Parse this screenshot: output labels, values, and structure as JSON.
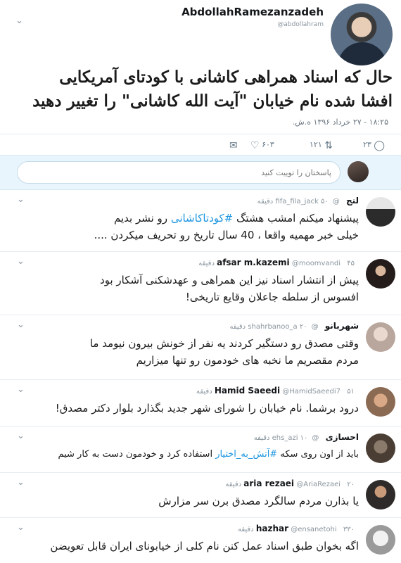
{
  "main_tweet": {
    "name": "AbdollahRamezanzadeh",
    "handle": "@abdollahram",
    "text_line1": "حال که اسناد همراهی کاشانی با کودتای آمریکایی",
    "text_line2": "افشا شده نام خیابان \"آیت الله کاشانی\" را تغییر دهید",
    "timestamp": "۱۸:۲۵ - ۲۷ خرداد ۱۳۹۶ ه.ش.",
    "likes": "۶۰۳",
    "retweets": "۱۲۱",
    "replies": "۲۳"
  },
  "reply_box": {
    "placeholder": "پاسختان را توییت کنید"
  },
  "replies": [
    {
      "name": "لنج",
      "handle": "@fifa_fila_jack",
      "time": "۵۰ دقیقه",
      "line1_pre": "پیشنهاد میکنم امشب هشتگ ",
      "line1_tag": "#کودتاکاشانی",
      "line1_post": " رو نشر بدیم",
      "line2": "خیلی خبر مهمیه واقعا ، 40 سال تاریخ رو تحریف میکردن ...."
    },
    {
      "name": "afsar m.kazemi",
      "handle": "@moomvandi",
      "time": "۴۵ دقیقه",
      "line1": "پیش از انتشار اسناد نیز این همراهی و عهدشکنی آشکار بود",
      "line2": "افسوس از سلطه جاعلان وقایع تاریخی!"
    },
    {
      "name": "شهربانو",
      "handle": "@shahrbanoo_a",
      "time": "۲۰ دقیقه",
      "line1": "وقتی مصدق رو دستگیر کردند یه نفر از خونش بیرون نیومد ما",
      "line2": "مردم مقصریم ما نخبه های خودمون رو تنها میزاریم"
    },
    {
      "name": "Hamid Saeedi",
      "handle": "@HamidSaeedi7",
      "time": "۵۱ دقیقه",
      "line1": "درود برشما. نام خیابان را شورای شهر جدید بگذارد بلوار دکتر مصدق!"
    },
    {
      "name": "احسازی",
      "handle": "@ehs_azi",
      "time": "۱۰ دقیقه",
      "line1_pre": "باید از اون روی سکه ",
      "line1_tag": "#آتش_به_اختیار",
      "line1_post": " استفاده کرد و خودمون دست به کار شیم"
    },
    {
      "name": "aria rezaei",
      "handle": "@AriaRezaei",
      "time": "۲۰ دقیقه",
      "line1": "یا بذارن مردم سالگرد مصدق برن سر مزارش"
    },
    {
      "name": "hazhar",
      "handle": "@ensanetohi",
      "time": "۳۳۰ دقیقه",
      "line1": "اگه بخوان طبق اسناد عمل کنن نام کلی از خیابونای ایران قابل تعویضن"
    }
  ]
}
